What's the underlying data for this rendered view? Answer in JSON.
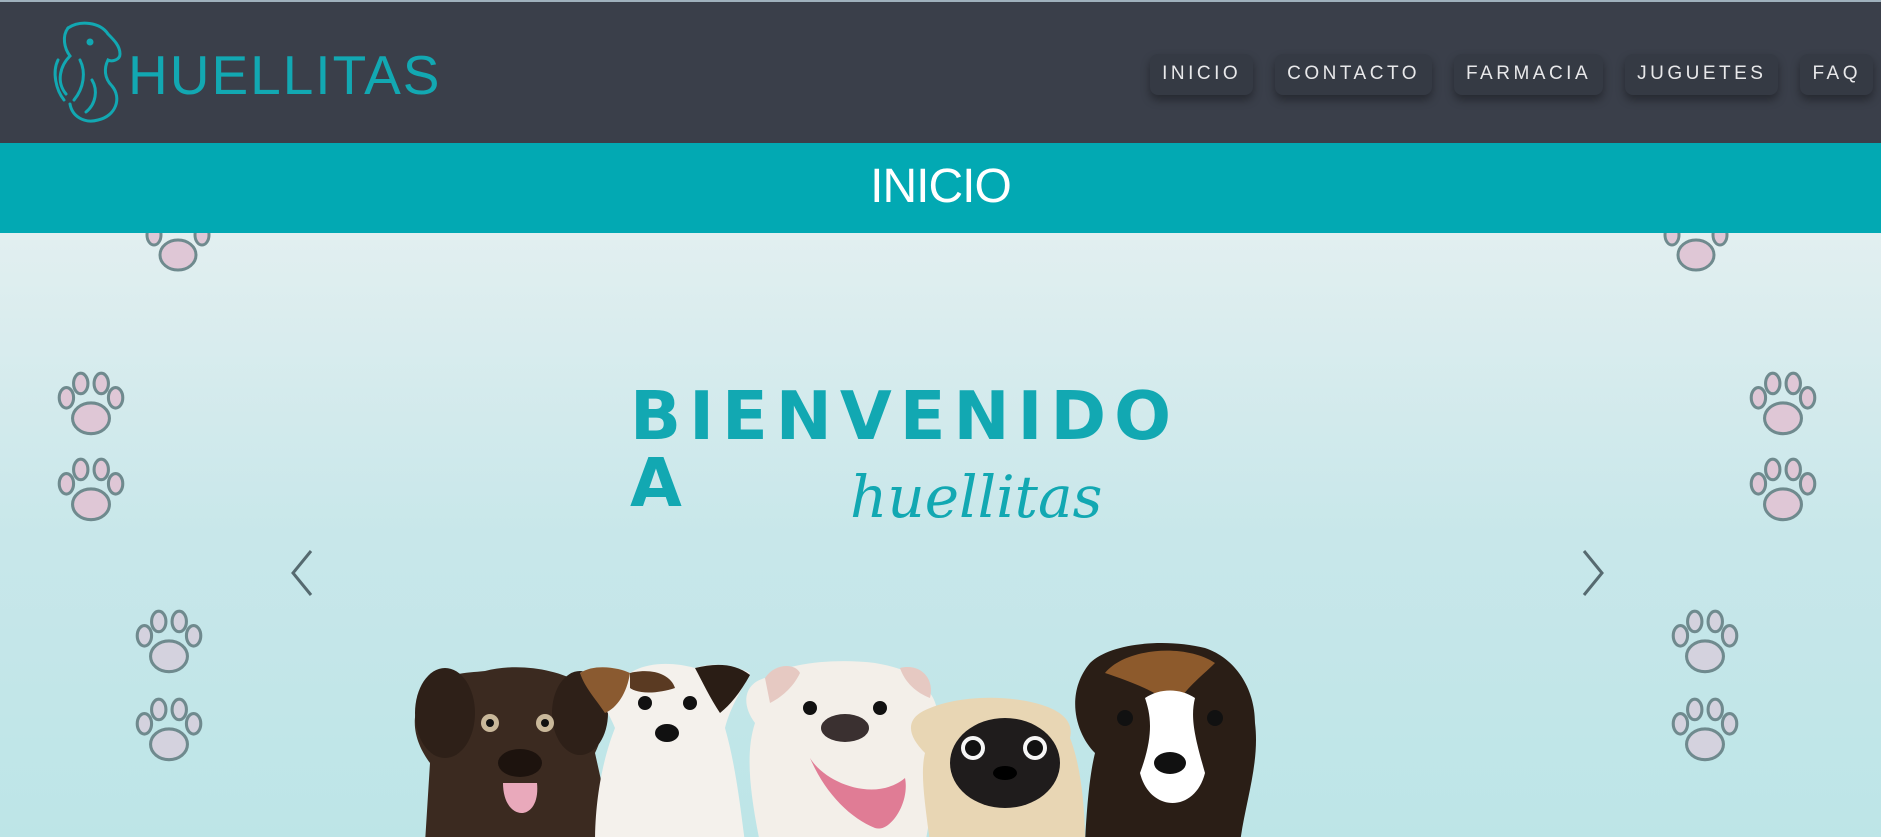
{
  "header": {
    "logo_text": "HUELLITAS",
    "nav": [
      "INICIO",
      "CONTACTO",
      "FARMACIA",
      "JUGUETES",
      "FAQ"
    ]
  },
  "section": {
    "title": "INICIO"
  },
  "hero": {
    "heading": "BIENVENIDO A",
    "brand": "huellitas",
    "prev_icon": "chevron-left-icon",
    "next_icon": "chevron-right-icon"
  },
  "colors": {
    "header_bg": "#3a3f4a",
    "accent": "#02a9b3",
    "brand_text": "#12a8b2",
    "hero_bg": "#c3e6e8"
  }
}
